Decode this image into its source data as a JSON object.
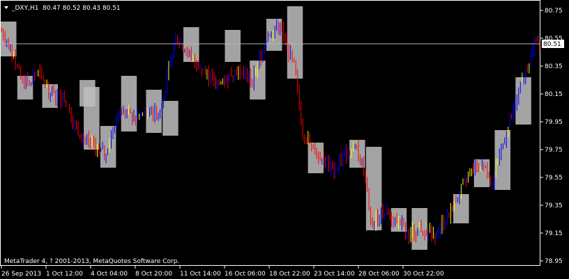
{
  "header": {
    "symbol_timeframe": "_DXY,H1",
    "ohlc": "80.47 80.52 80.43 80.51",
    "menu_icon": "triangle-down-icon"
  },
  "footer": {
    "copyright": "MetaTrader 4, ? 2001-2013, MetaQuotes Software Corp."
  },
  "colors": {
    "background": "#000000",
    "frame": "#ffffff",
    "price_line": "#b4b4b4",
    "up_color": "#0000ff",
    "down_color": "#ff0000",
    "up_alt": "#ffff00",
    "box_color": "#c0c0c0"
  },
  "chart_data": {
    "type": "candlestick",
    "title": "_DXY,H1",
    "current_price": 80.51,
    "current_price_label": "80.51",
    "ylim": [
      78.92,
      80.82
    ],
    "yticks": [
      "80.75",
      "80.55",
      "80.35",
      "80.15",
      "79.95",
      "79.75",
      "79.55",
      "79.35",
      "79.15",
      "78.95"
    ],
    "ytick_values": [
      80.75,
      80.55,
      80.35,
      80.15,
      79.95,
      79.75,
      79.55,
      79.35,
      79.15,
      78.95
    ],
    "xticks": [
      "26 Sep 2013",
      "1 Oct 12:00",
      "4 Oct 04:00",
      "8 Oct 20:00",
      "11 Oct 14:00",
      "16 Oct 06:00",
      "18 Oct 22:00",
      "23 Oct 14:00",
      "28 Oct 06:00",
      "30 Oct 22:00"
    ],
    "bar_count": 310,
    "close_path": [
      [
        0,
        80.6
      ],
      [
        8,
        80.5
      ],
      [
        20,
        80.22
      ],
      [
        35,
        80.3
      ],
      [
        48,
        80.15
      ],
      [
        60,
        80.12
      ],
      [
        72,
        79.9
      ],
      [
        88,
        79.78
      ],
      [
        100,
        79.72
      ],
      [
        112,
        80.02
      ],
      [
        128,
        79.98
      ],
      [
        140,
        80.02
      ],
      [
        152,
        80.0
      ],
      [
        168,
        80.55
      ],
      [
        180,
        80.45
      ],
      [
        195,
        80.3
      ],
      [
        210,
        80.22
      ],
      [
        226,
        80.32
      ],
      [
        242,
        80.25
      ],
      [
        256,
        80.58
      ],
      [
        268,
        80.65
      ],
      [
        278,
        80.42
      ],
      [
        282,
        80.35
      ],
      [
        290,
        79.88
      ],
      [
        305,
        79.72
      ],
      [
        320,
        79.6
      ],
      [
        330,
        79.72
      ],
      [
        342,
        79.75
      ],
      [
        350,
        79.6
      ],
      [
        356,
        79.22
      ],
      [
        368,
        79.3
      ],
      [
        380,
        79.25
      ],
      [
        392,
        79.15
      ],
      [
        404,
        79.18
      ],
      [
        418,
        79.15
      ],
      [
        430,
        79.28
      ],
      [
        442,
        79.45
      ],
      [
        454,
        79.6
      ],
      [
        466,
        79.66
      ],
      [
        472,
        79.52
      ],
      [
        480,
        79.72
      ],
      [
        490,
        79.95
      ],
      [
        500,
        80.2
      ],
      [
        508,
        80.38
      ],
      [
        514,
        80.52
      ],
      [
        519,
        80.5
      ]
    ],
    "boxes": [
      {
        "start": 0,
        "open": 80.42,
        "close": 80.67
      },
      {
        "start": 16,
        "open": 80.28,
        "close": 80.11
      },
      {
        "start": 40,
        "open": 80.22,
        "close": 80.05
      },
      {
        "start": 76,
        "open": 80.06,
        "close": 80.25
      },
      {
        "start": 80,
        "open": 79.75,
        "close": 80.2
      },
      {
        "start": 96,
        "open": 79.62,
        "close": 79.92
      },
      {
        "start": 116,
        "open": 79.88,
        "close": 80.28
      },
      {
        "start": 140,
        "open": 79.87,
        "close": 80.18
      },
      {
        "start": 156,
        "open": 79.85,
        "close": 80.1
      },
      {
        "start": 176,
        "open": 80.38,
        "close": 80.63
      },
      {
        "start": 216,
        "open": 80.38,
        "close": 80.61
      },
      {
        "start": 240,
        "open": 80.11,
        "close": 80.39
      },
      {
        "start": 256,
        "open": 80.46,
        "close": 80.69
      },
      {
        "start": 276,
        "open": 80.26,
        "close": 80.78
      },
      {
        "start": 296,
        "open": 79.58,
        "close": 79.8
      },
      {
        "start": 336,
        "open": 79.62,
        "close": 79.82
      },
      {
        "start": 352,
        "open": 79.17,
        "close": 79.77
      },
      {
        "start": 376,
        "open": 79.16,
        "close": 79.33
      },
      {
        "start": 396,
        "open": 79.03,
        "close": 79.33
      },
      {
        "start": 436,
        "open": 79.22,
        "close": 79.43
      },
      {
        "start": 456,
        "open": 79.48,
        "close": 79.68
      },
      {
        "start": 476,
        "open": 79.46,
        "close": 79.89
      },
      {
        "start": 496,
        "open": 79.93,
        "close": 80.27
      }
    ]
  }
}
